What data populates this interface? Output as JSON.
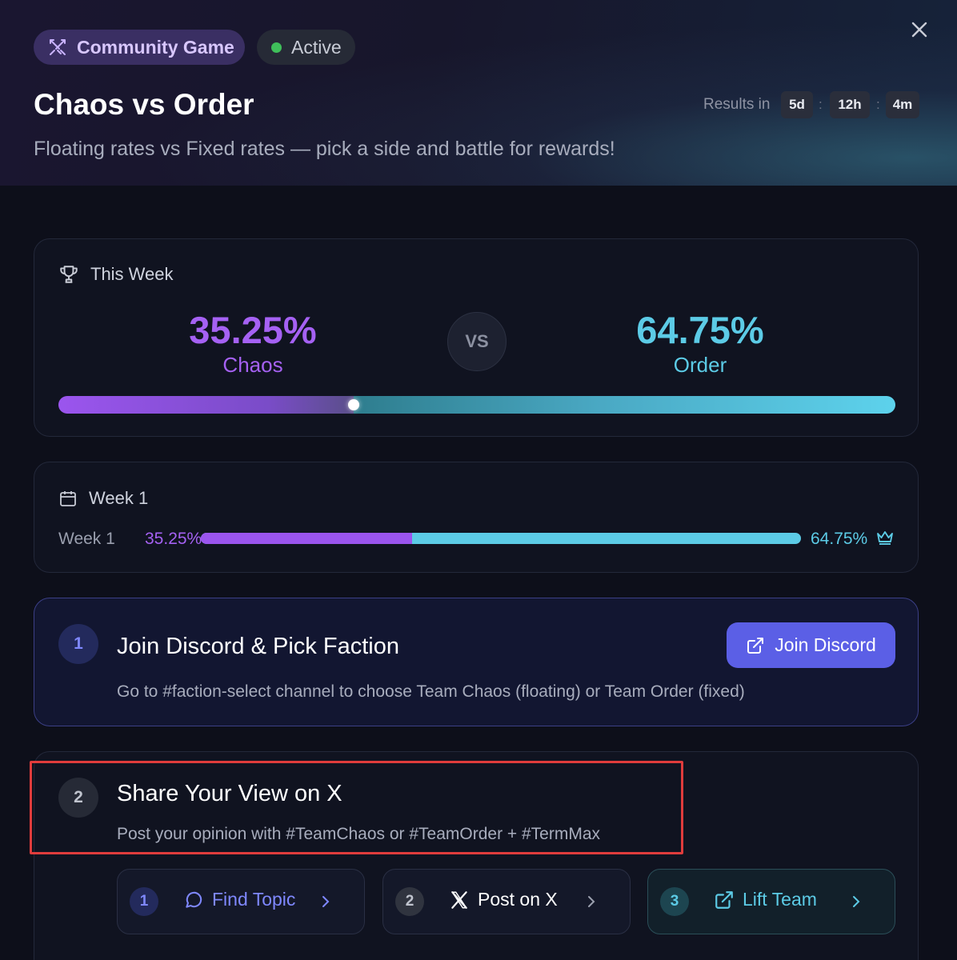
{
  "header": {
    "badge_community": "Community Game",
    "badge_status": "Active",
    "title": "Chaos vs Order",
    "subtitle": "Floating rates vs Fixed rates — pick a side and battle for rewards!",
    "results_label": "Results in",
    "countdown": {
      "days": "5d",
      "hours": "12h",
      "minutes": "4m",
      "separator": ":"
    }
  },
  "this_week": {
    "heading": "This Week",
    "chaos_pct": "35.25%",
    "chaos_label": "Chaos",
    "vs": "VS",
    "order_pct": "64.75%",
    "order_label": "Order",
    "chaos_fraction": 0.3525
  },
  "weeks": {
    "heading": "Week 1",
    "rows": [
      {
        "label": "Week 1",
        "chaos": "35.25%",
        "order": "64.75%",
        "chaos_fraction": 0.3525
      }
    ]
  },
  "steps": [
    {
      "number": "1",
      "title": "Join Discord & Pick Faction",
      "description": "Go to #faction-select channel to choose Team Chaos (floating) or Team Order (fixed)",
      "button_label": "Join Discord"
    },
    {
      "number": "2",
      "title": "Share Your View on X",
      "description": "Post your opinion with #TeamChaos or #TeamOrder + #TermMax",
      "actions": [
        {
          "number": "1",
          "label": "Find Topic"
        },
        {
          "number": "2",
          "label": "Post on X"
        },
        {
          "number": "3",
          "label": "Lift Team"
        }
      ]
    }
  ],
  "colors": {
    "chaos": "#a561f3",
    "order": "#5ccbe6",
    "discord_button": "#5b5fe6",
    "highlight": "#e03c3c"
  }
}
